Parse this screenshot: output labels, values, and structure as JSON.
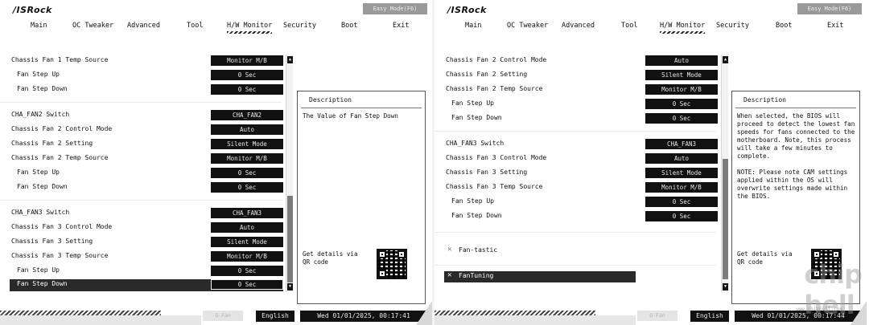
{
  "left": {
    "logo": "/ISRock",
    "easy_mode": "Easy Mode(F6)",
    "nav": [
      {
        "label": "Main"
      },
      {
        "label": "OC Tweaker"
      },
      {
        "label": "Advanced"
      },
      {
        "label": "Tool"
      },
      {
        "label": "H/W Monitor",
        "active": true
      },
      {
        "label": "Security"
      },
      {
        "label": "Boot"
      },
      {
        "label": "Exit"
      }
    ],
    "rows": [
      {
        "label": "Chassis Fan 1 Temp Source",
        "value": "Monitor M/B"
      },
      {
        "label": "Fan Step Up",
        "value": "0 Sec"
      },
      {
        "label": "Fan Step Down",
        "value": "0 Sec"
      },
      {
        "label": "CHA_FAN2 Switch",
        "value": "CHA_FAN2"
      },
      {
        "label": "Chassis Fan 2 Control Mode",
        "value": "Auto"
      },
      {
        "label": "Chassis Fan 2 Setting",
        "value": "Silent Mode"
      },
      {
        "label": "Chassis Fan 2 Temp Source",
        "value": "Monitor M/B"
      },
      {
        "label": "Fan Step Up",
        "value": "0 Sec"
      },
      {
        "label": "Fan Step Down",
        "value": "0 Sec"
      },
      {
        "label": "CHA_FAN3 Switch",
        "value": "CHA_FAN3"
      },
      {
        "label": "Chassis Fan 3 Control Mode",
        "value": "Auto"
      },
      {
        "label": "Chassis Fan 3 Setting",
        "value": "Silent Mode"
      },
      {
        "label": "Chassis Fan 3 Temp Source",
        "value": "Monitor M/B"
      },
      {
        "label": "Fan Step Up",
        "value": "0 Sec"
      },
      {
        "label": "Fan Step Down",
        "value": "0 Sec"
      }
    ],
    "description": {
      "title": "Description",
      "text": "The Value of Fan Step Down",
      "qr_text": "Get details via QR code"
    },
    "qfan": "Q-Fan",
    "language": "English",
    "datetime": "Wed 01/01/2025, 00:17:41"
  },
  "right": {
    "logo": "/ISRock",
    "easy_mode": "Easy Mode(F6)",
    "nav": [
      {
        "label": "Main"
      },
      {
        "label": "OC Tweaker"
      },
      {
        "label": "Advanced"
      },
      {
        "label": "Tool"
      },
      {
        "label": "H/W Monitor",
        "active": true
      },
      {
        "label": "Security"
      },
      {
        "label": "Boot"
      },
      {
        "label": "Exit"
      }
    ],
    "rows": [
      {
        "label": "Chassis Fan 2 Control Mode",
        "value": "Auto"
      },
      {
        "label": "Chassis Fan 2 Setting",
        "value": "Silent Mode"
      },
      {
        "label": "Chassis Fan 2 Temp Source",
        "value": "Monitor M/B"
      },
      {
        "label": "Fan Step Up",
        "value": "0 Sec"
      },
      {
        "label": "Fan Step Down",
        "value": "0 Sec"
      },
      {
        "label": "CHA_FAN3 Switch",
        "value": "CHA_FAN3"
      },
      {
        "label": "Chassis Fan 3 Control Mode",
        "value": "Auto"
      },
      {
        "label": "Chassis Fan 3 Setting",
        "value": "Silent Mode"
      },
      {
        "label": "Chassis Fan 3 Temp Source",
        "value": "Monitor M/B"
      },
      {
        "label": "Fan Step Up",
        "value": "0 Sec"
      },
      {
        "label": "Fan Step Down",
        "value": "0 Sec"
      }
    ],
    "tools": [
      {
        "label": "Fan-tastic",
        "icon": "wrench-icon"
      },
      {
        "label": "FanTuning",
        "icon": "wrench-icon"
      }
    ],
    "description": {
      "title": "Description",
      "text": "When selected, the BIOS will proceed to detect the lowest fan speeds for fans connected to the motherboard. Note, this process will take a few minutes to complete.\n\nNOTE: Please note CAM settings applied within the OS will overwrite settings made within the BIOS.",
      "qr_text": "Get details via QR code"
    },
    "qfan": "Q-Fan",
    "language": "English",
    "datetime": "Wed 01/01/2025, 00:17:44",
    "watermark": "chip\nhell",
    "watermark_url": "www.chiphell.com"
  }
}
